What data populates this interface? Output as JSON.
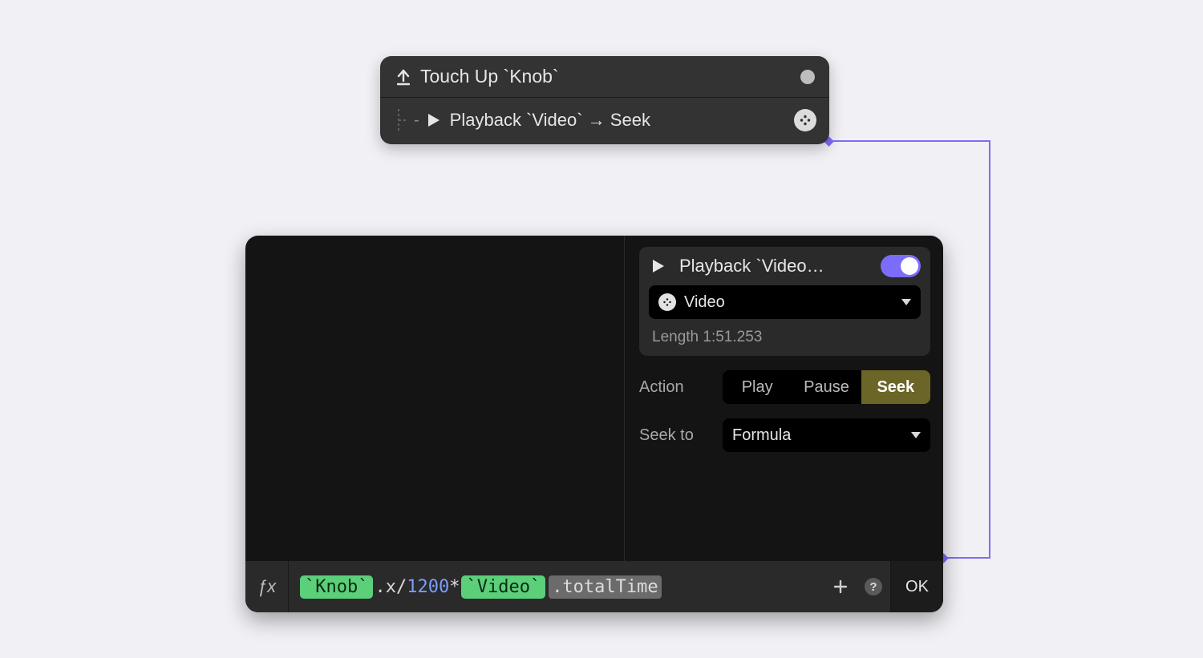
{
  "colors": {
    "accent": "#7c6cfa",
    "seg_active": "#6b6628",
    "token_green": "#5bcf7a"
  },
  "trigger": {
    "icon": "arrow-up-icon",
    "title": "Touch Up `Knob`",
    "child": {
      "icon": "play-icon",
      "label": "Playback `Video` → Seek",
      "badge_icon": "film-reel-icon"
    }
  },
  "inspector": {
    "header": {
      "icon": "play-icon",
      "title": "Playback `Video…",
      "enabled": true
    },
    "target": {
      "icon": "film-reel-icon",
      "value": "Video",
      "length_label": "Length 1:51.253"
    },
    "action": {
      "label": "Action",
      "options": [
        "Play",
        "Pause",
        "Seek"
      ],
      "selected": "Seek"
    },
    "seek_to": {
      "label": "Seek to",
      "value": "Formula"
    }
  },
  "formula_bar": {
    "fx_label": "ƒx",
    "tokens": [
      {
        "kind": "ref",
        "text": "`Knob`"
      },
      {
        "kind": "prop",
        "text": ".x"
      },
      {
        "kind": "op",
        "text": "/"
      },
      {
        "kind": "num",
        "text": "1200"
      },
      {
        "kind": "op",
        "text": "*"
      },
      {
        "kind": "ref",
        "text": "`Video`"
      },
      {
        "kind": "prop",
        "text": ".totalTime"
      }
    ],
    "add_icon": "plus-icon",
    "help_icon": "help-icon",
    "ok_label": "OK"
  }
}
